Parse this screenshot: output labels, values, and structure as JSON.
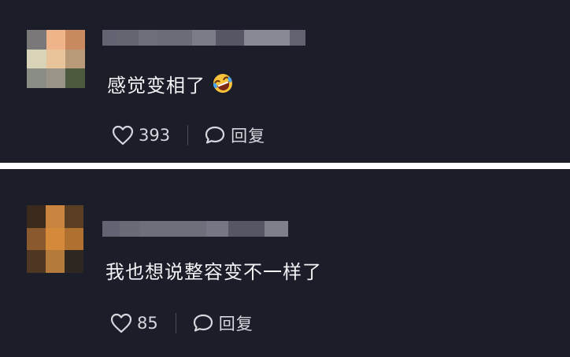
{
  "comments": [
    {
      "text": "感觉变相了",
      "emoji": "rofl-emoji",
      "likes": "393",
      "reply_label": "回复",
      "avatar_colors": [
        "#7a7878",
        "#f0b48a",
        "#c98a62",
        "#d9d4b8",
        "#e9c49a",
        "#b89a78",
        "#8a8c86",
        "#9a9488",
        "#4e5a3e"
      ],
      "username_colors": [
        "#6f7180",
        "#8a8c98",
        "#7c7e8a",
        "#9597a3",
        "#8b8d99",
        "#747684",
        "#9a9ca8",
        "#878996"
      ]
    },
    {
      "text": "我也想说整容变不一样了",
      "likes": "85",
      "reply_label": "回复",
      "avatar_colors": [
        "#3a2a1e",
        "#c98440",
        "#5a3e24",
        "#8a5a2e",
        "#d48a3a",
        "#b07030",
        "#4e3622",
        "#b47a3c",
        "#2e2620"
      ],
      "username_colors": [
        "#6f7180",
        "#9395a1",
        "#7c7e8a",
        "#9a9ca8",
        "#858794",
        "#747684",
        "#8e909c"
      ]
    }
  ],
  "colors": {
    "background": "#1b1d29",
    "separator": "#ffffff",
    "text": "#f2f2f4",
    "meta": "#d6d7dc"
  }
}
